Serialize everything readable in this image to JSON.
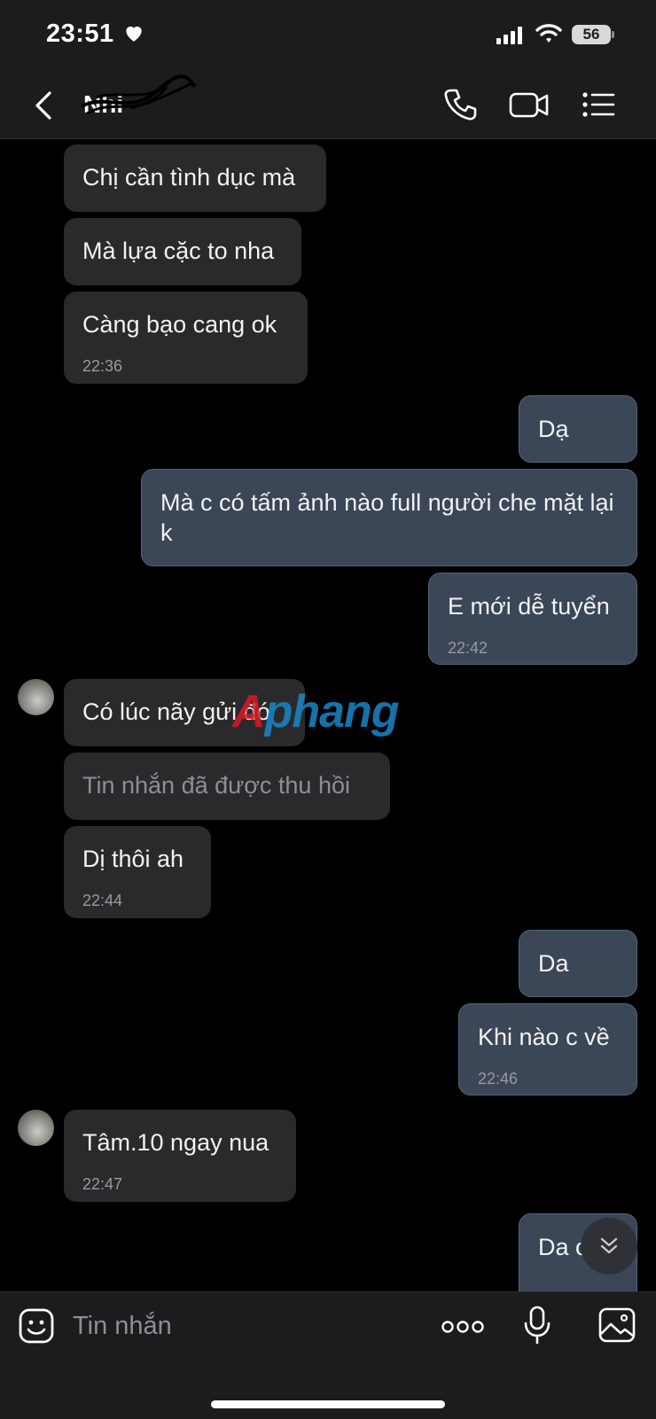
{
  "status_bar": {
    "time": "23:51",
    "battery": "56"
  },
  "header": {
    "contact_name": "Nhi"
  },
  "messages": [
    {
      "side": "in",
      "text": "Chị cần tình dục mà"
    },
    {
      "side": "in",
      "text": "Mà lựa cặc to nha"
    },
    {
      "side": "in",
      "text": "Càng bạo cang ok",
      "time": "22:36"
    },
    {
      "side": "out",
      "text": "Dạ"
    },
    {
      "side": "out",
      "text": "Mà c có tấm ảnh nào full người che mặt lại k"
    },
    {
      "side": "out",
      "text": "E mới dễ tuyển",
      "time": "22:42"
    },
    {
      "side": "in",
      "text": "Có lúc nãy gửi đó"
    },
    {
      "side": "in",
      "text": "Tin nhắn đã được thu hồi",
      "recalled": true
    },
    {
      "side": "in",
      "text": "Dị thôi ah",
      "time": "22:44"
    },
    {
      "side": "out",
      "text": "Da"
    },
    {
      "side": "out",
      "text": "Khi nào c về",
      "time": "22:46"
    },
    {
      "side": "in",
      "text": "Tâm.10 ngay nua",
      "time": "22:47"
    },
    {
      "side": "out",
      "text": "Da ok"
    }
  ],
  "watermark": {
    "part1": "A",
    "part2": "phang"
  },
  "composer": {
    "placeholder": "Tin nhắn"
  },
  "icons": {
    "back": "chevron-left-icon",
    "call": "phone-icon",
    "video": "video-camera-icon",
    "menu": "list-menu-icon",
    "sticker": "sticker-face-icon",
    "more": "more-dots-icon",
    "mic": "microphone-icon",
    "image": "image-icon",
    "scroll": "double-chevron-down-icon"
  },
  "colors": {
    "incoming": "#2a2a2c",
    "outgoing": "#3b4656",
    "background": "#000000"
  }
}
